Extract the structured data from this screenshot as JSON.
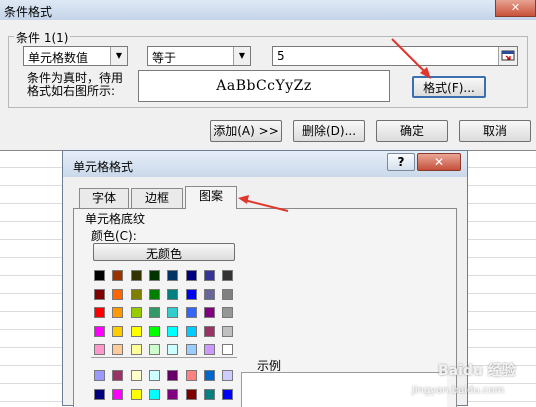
{
  "cf_dialog": {
    "title": "条件格式",
    "close_glyph": "✕",
    "group_label": "条件 1(1)",
    "condition_type": "单元格数值",
    "operator": "等于",
    "value": "5",
    "cond_text_line1": "条件为真时，待用",
    "cond_text_line2": "格式如右图所示:",
    "preview_text": "AaBbCcYyZz",
    "format_button": "格式(F)...",
    "add_button": "添加(A) >>",
    "delete_button": "删除(D)...",
    "ok_button": "确定",
    "cancel_button": "取消"
  },
  "format_cells_dialog": {
    "title": "单元格格式",
    "help_glyph": "?",
    "close_glyph": "✕",
    "tabs": [
      {
        "label": "字体"
      },
      {
        "label": "边框"
      },
      {
        "label": "图案"
      }
    ],
    "active_tab": "图案",
    "shading_label": "单元格底纹",
    "color_label": "颜色(C):",
    "no_color_button": "无颜色",
    "sample_label": "示例",
    "palette": [
      [
        "#000000",
        "#993300",
        "#333300",
        "#003300",
        "#003366",
        "#000080",
        "#333399",
        "#333333"
      ],
      [
        "#800000",
        "#FF6600",
        "#808000",
        "#008000",
        "#008080",
        "#0000FF",
        "#666699",
        "#808080"
      ],
      [
        "#FF0000",
        "#FF9900",
        "#99CC00",
        "#339966",
        "#33CCCC",
        "#3366FF",
        "#800080",
        "#969696"
      ],
      [
        "#FF00FF",
        "#FFCC00",
        "#FFFF00",
        "#00FF00",
        "#00FFFF",
        "#00CCFF",
        "#993366",
        "#C0C0C0"
      ],
      [
        "#FF99CC",
        "#FFCC99",
        "#FFFF99",
        "#CCFFCC",
        "#CCFFFF",
        "#99CCFF",
        "#CC99FF",
        "#FFFFFF"
      ]
    ],
    "palette_extra": [
      [
        "#9999FF",
        "#993366",
        "#FFFFCC",
        "#CCFFFF",
        "#660066",
        "#FF8080",
        "#0066CC",
        "#CCCCFF"
      ],
      [
        "#000080",
        "#FF00FF",
        "#FFFF00",
        "#00FFFF",
        "#800080",
        "#800000",
        "#008080",
        "#0000FF"
      ]
    ]
  },
  "watermark": {
    "line1": "Baidu 经验",
    "line2": "jingyan.baidu.com"
  },
  "colors": {
    "annotation_arrow": "#e0362c"
  }
}
